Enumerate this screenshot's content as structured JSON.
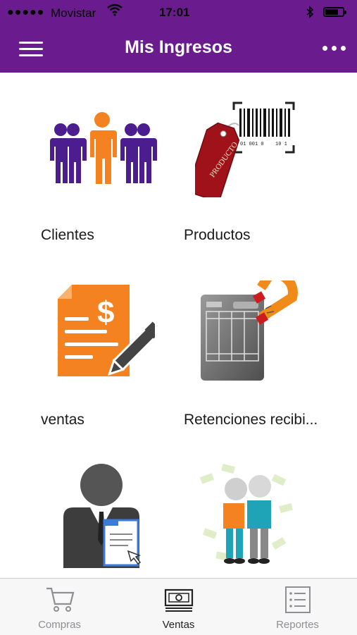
{
  "status_bar": {
    "signal": "●●●●●",
    "carrier": "Movistar",
    "time": "17:01"
  },
  "header": {
    "title": "Mis Ingresos"
  },
  "grid": {
    "items": [
      {
        "label": "Clientes",
        "icon": "clients-icon"
      },
      {
        "label": "Productos",
        "icon": "products-icon"
      },
      {
        "label": "ventas",
        "icon": "sales-icon"
      },
      {
        "label": "Retenciones recibi...",
        "icon": "retentions-icon"
      },
      {
        "label": "",
        "icon": "advisor-icon"
      },
      {
        "label": "",
        "icon": "partners-icon"
      }
    ]
  },
  "tabs": [
    {
      "label": "Compras",
      "icon": "cart-icon",
      "active": false
    },
    {
      "label": "Ventas",
      "icon": "money-icon",
      "active": true
    },
    {
      "label": "Reportes",
      "icon": "list-icon",
      "active": false
    }
  ],
  "colors": {
    "header_bg": "#6a1b8e",
    "accent_orange": "#f58220",
    "accent_purple": "#4b1d8f"
  }
}
